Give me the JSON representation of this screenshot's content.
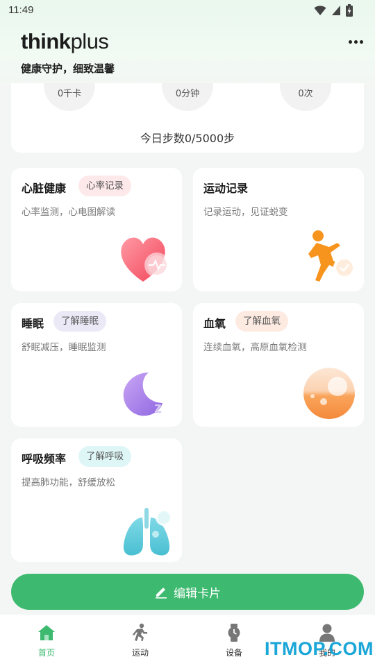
{
  "status_bar": {
    "time": "11:49",
    "icons": [
      "wifi-icon",
      "signal-icon",
      "battery-charging-icon"
    ]
  },
  "header": {
    "logo_think": "think",
    "logo_plus": "plus",
    "subtitle": "健康守护，细致温馨",
    "more_icon": "more-icon"
  },
  "steps_card": {
    "stats": [
      "0千卡",
      "0分钟",
      "0次"
    ],
    "steps_text": "今日步数0/5000步"
  },
  "cards": [
    {
      "title": "心脏健康",
      "tag": "心率记录",
      "desc": "心率监测，心电图解读",
      "icon": "heart-icon",
      "tag_color": "#fde8ea"
    },
    {
      "title": "运动记录",
      "tag": "",
      "desc": "记录运动，见证蜕变",
      "icon": "running-icon"
    },
    {
      "title": "睡眠",
      "tag": "了解睡眠",
      "desc": "舒眠减压，睡眠监测",
      "icon": "moon-icon",
      "tag_color": "#ece9f7"
    },
    {
      "title": "血氧",
      "tag": "了解血氧",
      "desc": "连续血氧，高原血氧检测",
      "icon": "blood-oxygen-icon",
      "tag_color": "#fdebe2"
    },
    {
      "title": "呼吸频率",
      "tag": "了解呼吸",
      "desc": "提高肺功能，舒缓放松",
      "icon": "lungs-icon",
      "tag_color": "#dff6f6"
    }
  ],
  "edit_button": {
    "label": "编辑卡片",
    "icon": "pencil-icon",
    "color": "#3dba6f"
  },
  "bottom_nav": [
    {
      "label": "首页",
      "icon": "home-icon",
      "active": true
    },
    {
      "label": "运动",
      "icon": "run-icon",
      "active": false
    },
    {
      "label": "设备",
      "icon": "watch-icon",
      "active": false
    },
    {
      "label": "我的",
      "icon": "user-icon",
      "active": false
    }
  ],
  "watermark": "ITMOP.COM"
}
